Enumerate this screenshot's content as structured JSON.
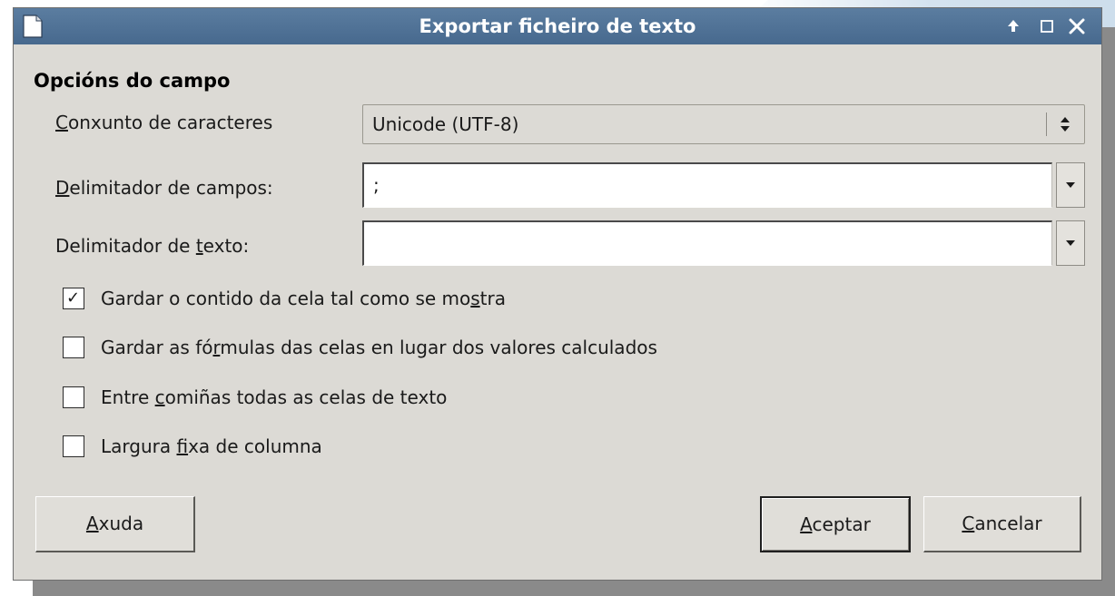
{
  "window": {
    "title": "Exportar ficheiro de texto",
    "icon": "document-icon",
    "controls": [
      "up-arrow-icon",
      "maximize-icon",
      "close-icon"
    ]
  },
  "section": {
    "title": "Opcións do campo"
  },
  "fields": {
    "charset": {
      "label_mnemonic": "C",
      "label_rest": "onxunto de caracteres",
      "value": "Unicode (UTF-8)"
    },
    "field_delimiter": {
      "label_mnemonic": "D",
      "label_rest": "elimitador de campos:",
      "value": ";"
    },
    "text_delimiter": {
      "label_before": "Delimitador de ",
      "label_mnemonic": "t",
      "label_after": "exto:",
      "value": ""
    }
  },
  "options": [
    {
      "before": "Gardar o contido da cela tal como se mo",
      "mnemonic": "s",
      "after": "tra",
      "checked": true
    },
    {
      "before": "Gardar as fó",
      "mnemonic": "r",
      "after": "mulas das celas en lugar dos valores calculados",
      "checked": false
    },
    {
      "before": "Entre ",
      "mnemonic": "c",
      "after": "omiñas todas as celas de texto",
      "checked": false
    },
    {
      "before": "Largura ",
      "mnemonic": "f",
      "after": "ixa de columna",
      "checked": false
    }
  ],
  "buttons": {
    "help": {
      "mnemonic": "A",
      "rest": "xuda"
    },
    "ok": {
      "mnemonic": "A",
      "rest": "ceptar"
    },
    "cancel": {
      "mnemonic": "C",
      "rest": "ancelar"
    }
  },
  "colors": {
    "titlebar": "#5b7da0",
    "dialog_bg": "#dcdad5"
  }
}
